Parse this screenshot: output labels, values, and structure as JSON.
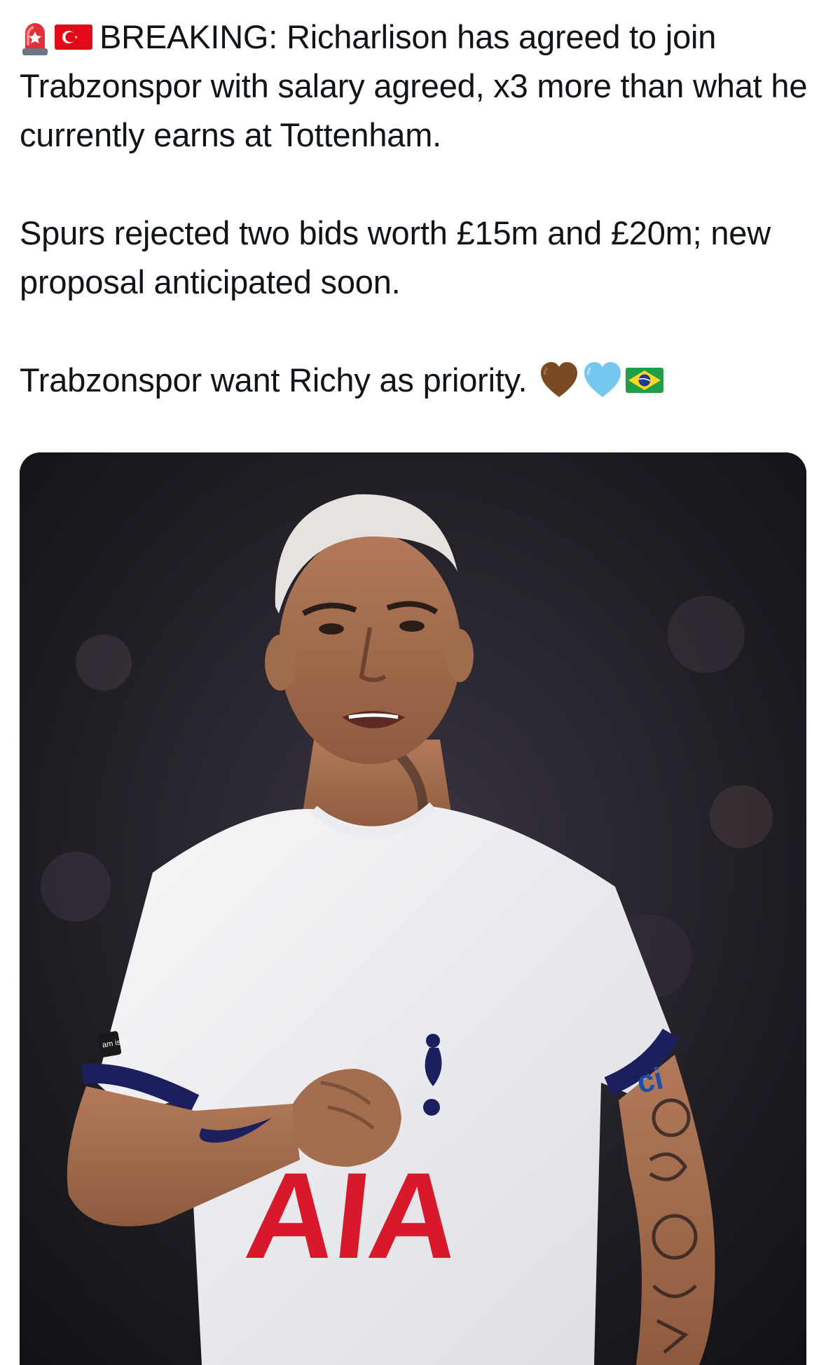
{
  "tweet": {
    "line1": "BREAKING: Richarlison has agreed to join Trabzonspor with salary agreed, x3 more than what he currently earns at Tottenham.",
    "line2": "Spurs rejected two bids worth £15m and £20m; new proposal anticipated soon.",
    "line3": "Trabzonspor want Richy as priority.",
    "leading_icons": [
      "rotating-light-icon",
      "turkey-flag-icon"
    ],
    "trailing_icons": [
      "brown-heart-icon",
      "light-blue-heart-icon",
      "brazil-flag-icon"
    ]
  },
  "media": {
    "kind": "photo",
    "description_icon": "player-photo",
    "shirt_sponsor": "AIA",
    "sleeve_sponsor": "ci",
    "badge_text": "am ism"
  },
  "colors": {
    "brown_heart": "#7a4a22",
    "light_blue_heart": "#76c8ee",
    "brand_red": "#d7192b",
    "navy": "#1b1f5e"
  }
}
